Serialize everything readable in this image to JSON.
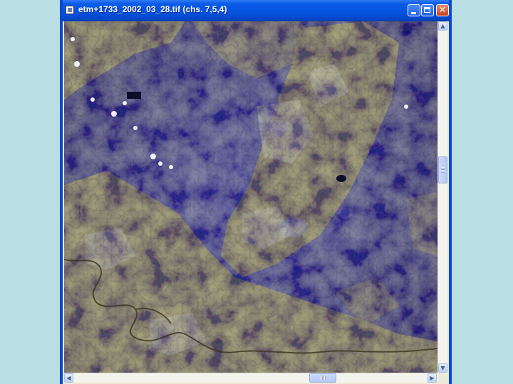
{
  "window": {
    "title": "etm+1733_2002_03_28.tif (chs. 7,5,4)",
    "close_glyph": "✕"
  },
  "image": {
    "description_icon": "satellite-image",
    "colors": {
      "water_blue": "#1c23a0",
      "land_olive": "#8f8b4a",
      "highlight": "#c9cba8"
    }
  },
  "scrollbars": {
    "up_arrow": "▲",
    "down_arrow": "▼",
    "left_arrow": "◀",
    "right_arrow": "▶"
  }
}
